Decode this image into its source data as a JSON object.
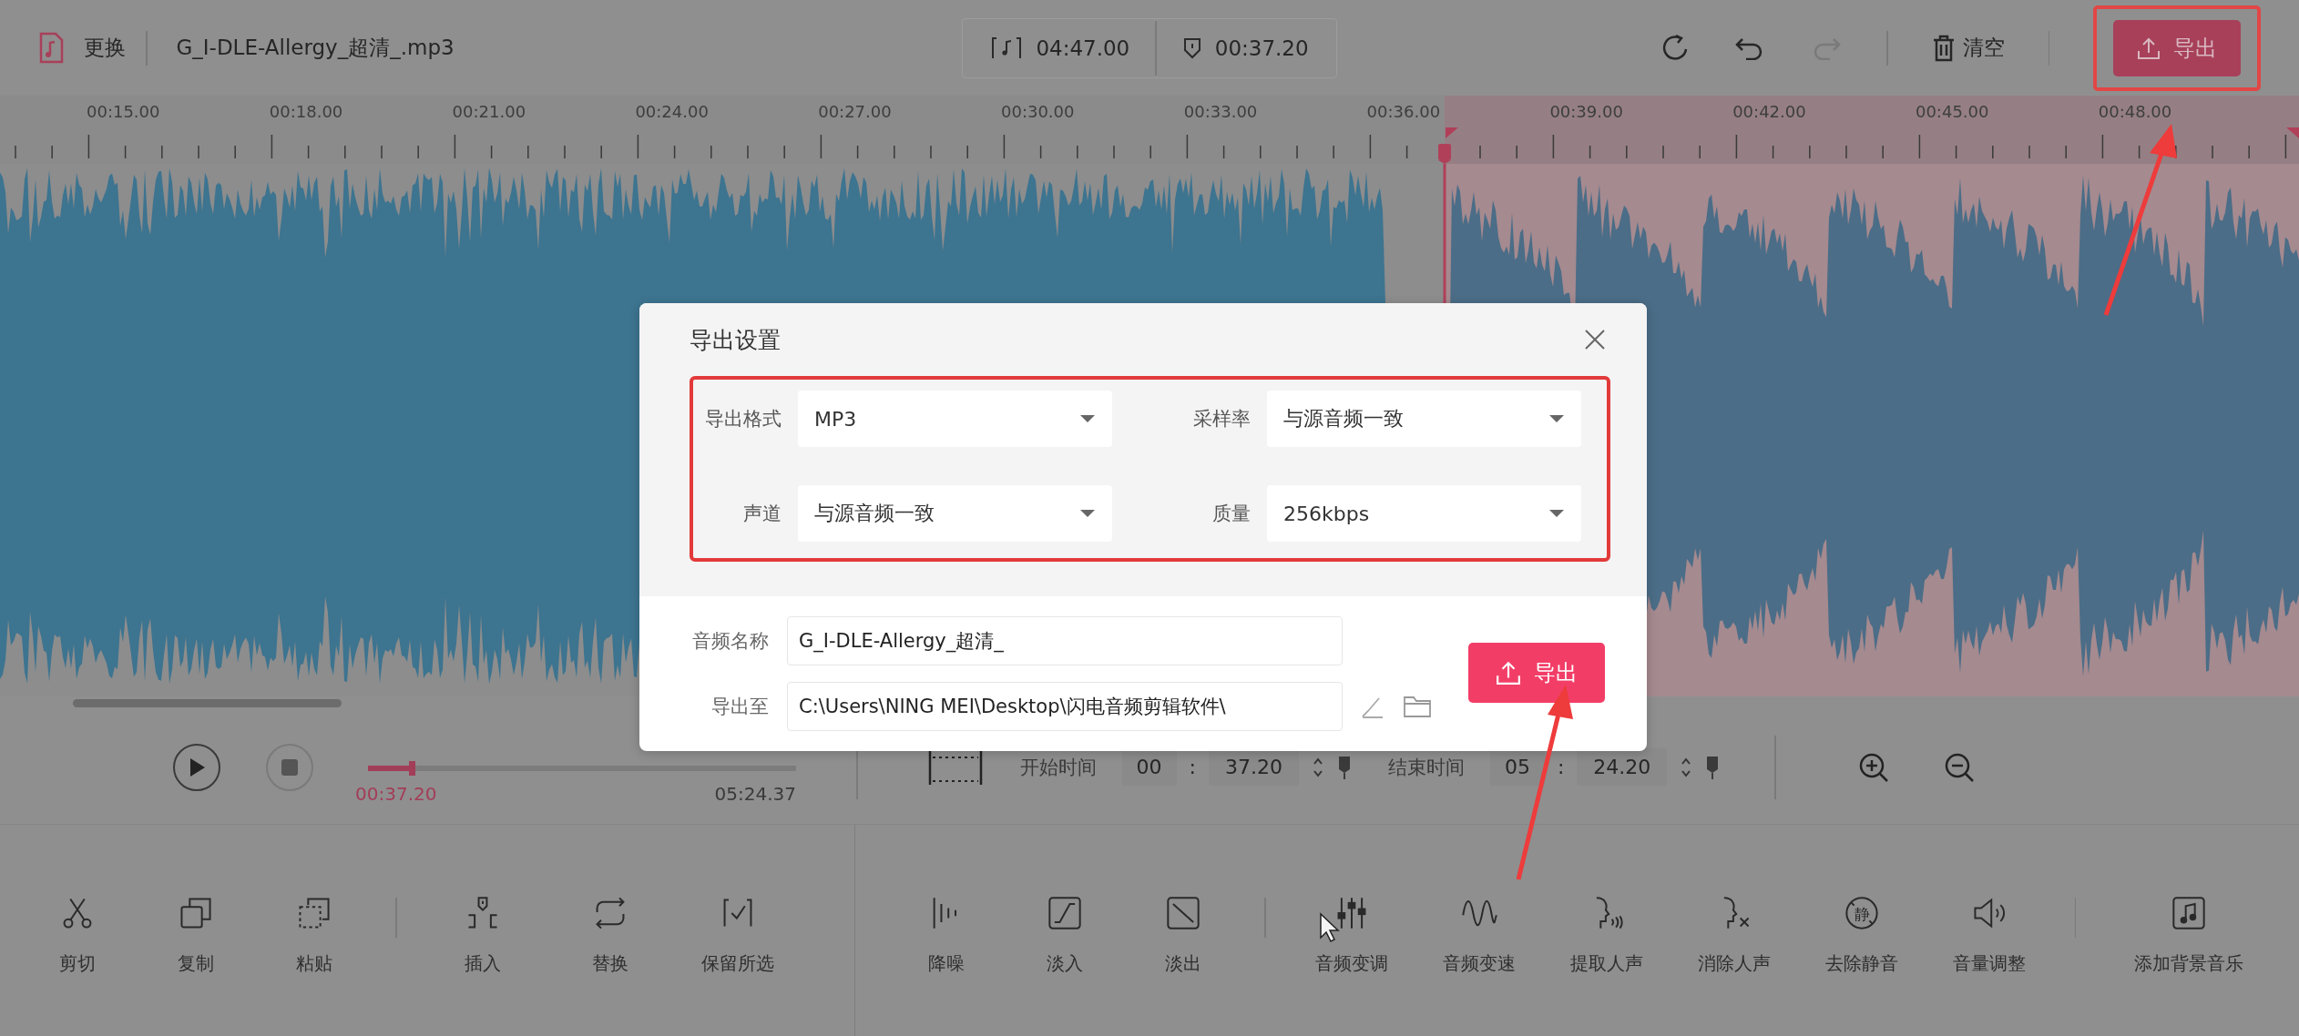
{
  "header": {
    "replace_label": "更换",
    "filename": "G_I-DLE-Allergy_超清_.mp3",
    "duration": "04:47.00",
    "selection_time": "00:37.20",
    "history": [
      {
        "kind": "undo",
        "disabled": false
      },
      {
        "kind": "redo",
        "disabled": true
      }
    ],
    "clear_label": "清空",
    "export_label": "导出"
  },
  "ruler": {
    "labels": [
      "00:15.00",
      "00:18.00",
      "00:21.00",
      "00:24.00",
      "00:27.00",
      "00:30.00",
      "00:33.00",
      "00:36.00",
      "00:39.00",
      "00:42.00",
      "00:45.00",
      "00:48.00"
    ]
  },
  "player": {
    "level": 0.11,
    "current": "00:37.20",
    "total": "05:24.37"
  },
  "range": {
    "start": {
      "label": "开始时间",
      "minutes": "00",
      "separator": ":",
      "seconds": "37.20"
    },
    "end": {
      "label": "结束时间",
      "minutes": "05",
      "separator": ":",
      "seconds": "24.20"
    }
  },
  "toolbar": {
    "left_groups": [
      [
        {
          "label": "剪切",
          "kind": "scissors"
        },
        {
          "label": "复制",
          "kind": "copy"
        },
        {
          "label": "粘贴",
          "kind": "paste"
        }
      ],
      [
        {
          "label": "插入",
          "kind": "marker"
        },
        {
          "label": "替换",
          "kind": "swap"
        },
        {
          "label": "保留所选",
          "kind": "bracket-check"
        }
      ]
    ],
    "right_groups": [
      [
        {
          "label": "降噪",
          "kind": "bars"
        },
        {
          "label": "淡入",
          "kind": "fade-in"
        },
        {
          "label": "淡出",
          "kind": "fade-out"
        }
      ],
      [
        {
          "label": "音频变调",
          "kind": "sliders"
        },
        {
          "label": "音频变速",
          "kind": "wave"
        },
        {
          "label": "提取人声",
          "kind": "voice"
        },
        {
          "label": "消除人声",
          "kind": "voice-remove"
        },
        {
          "label": "去除静音",
          "kind": "silence",
          "badge": "静"
        },
        {
          "label": "音量调整",
          "kind": "speaker"
        }
      ],
      [
        {
          "label": "添加背景音乐",
          "kind": "music-note"
        }
      ]
    ]
  },
  "dialog": {
    "title": "导出设置",
    "settings": [
      {
        "label": "导出格式",
        "value": "MP3"
      },
      {
        "label": "采样率",
        "value": "与源音频一致"
      },
      {
        "label": "声道",
        "value": "与源音频一致"
      },
      {
        "label": "质量",
        "value": "256kbps"
      }
    ],
    "name_label": "音频名称",
    "name_value": "G_I-DLE-Allergy_超清_",
    "path_label": "导出至",
    "path_value": "C:\\Users\\NING MEI\\Desktop\\闪电音频剪辑软件\\",
    "export_label": "导出"
  }
}
